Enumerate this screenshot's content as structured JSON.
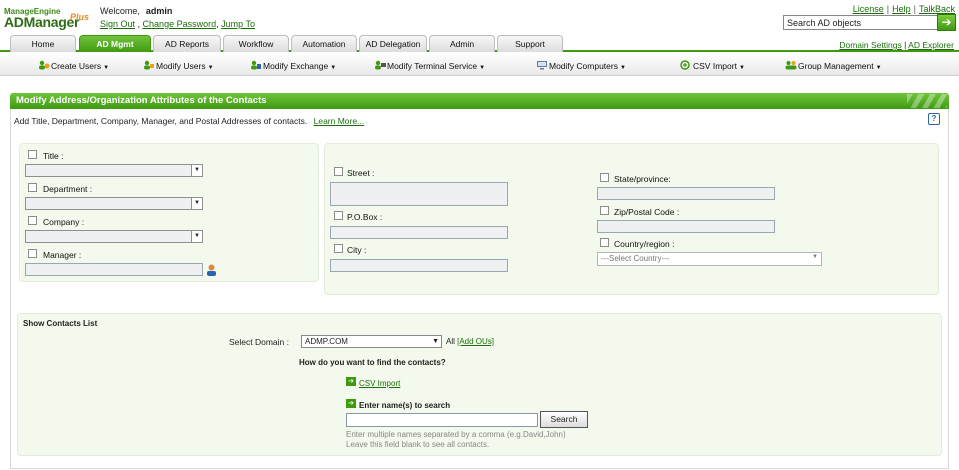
{
  "header": {
    "logo_top": "ManageEngine",
    "logo_main": "ADManager",
    "logo_plus": "Plus",
    "welcome_text": "Welcome,",
    "username": "admin",
    "sign_out": "Sign Out",
    "change_password": "Change Password",
    "jump_to": "Jump To",
    "links": [
      "License",
      "Help",
      "TalkBack"
    ],
    "search_placeholder": "Search AD objects",
    "search_go": "➔"
  },
  "tabs": [
    {
      "label": "Home"
    },
    {
      "label": "AD Mgmt",
      "active": true
    },
    {
      "label": "AD Reports"
    },
    {
      "label": "Workflow"
    },
    {
      "label": "Automation"
    },
    {
      "label": "AD Delegation"
    },
    {
      "label": "Admin"
    },
    {
      "label": "Support"
    }
  ],
  "right_links": [
    "Domain Settings",
    "AD Explorer"
  ],
  "menu": [
    "Create Users",
    "Modify Users",
    "Modify Exchange",
    "Modify Terminal Service",
    "Modify Computers",
    "CSV Import",
    "Group Management"
  ],
  "panel": {
    "title": "Modify Address/Organization Attributes of the Contacts",
    "description": "Add Title, Department, Company, Manager, and Postal Addresses of contacts.",
    "learn_more": "Learn More...",
    "help": "?"
  },
  "fields": {
    "title": "Title :",
    "department": "Department :",
    "company": "Company :",
    "manager": "Manager :",
    "street": "Street :",
    "pobox": "P.O.Box :",
    "city": "City :",
    "state": "State/province:",
    "zip": "Zip/Postal Code :",
    "country": "Country/region :",
    "country_placeholder": "---Select Country---"
  },
  "contacts": {
    "section_title": "Show Contacts List",
    "select_domain_label": "Select Domain :",
    "domain_value": "ADMP.COM",
    "all_text": "All",
    "add_ous": "[Add OUs]",
    "question": "How do you want to find the contacts?",
    "csv_import": "CSV Import",
    "enter_names": "Enter name(s) to search",
    "search_button": "Search",
    "hint1": "Enter multiple names separated by a comma (e.g.David,John)",
    "hint2": "Leave this field blank to see all contacts."
  },
  "colors": {
    "brand_green": "#3f9a12",
    "link_green": "#1a6e0a",
    "panel_bg": "#f3f9ec"
  }
}
